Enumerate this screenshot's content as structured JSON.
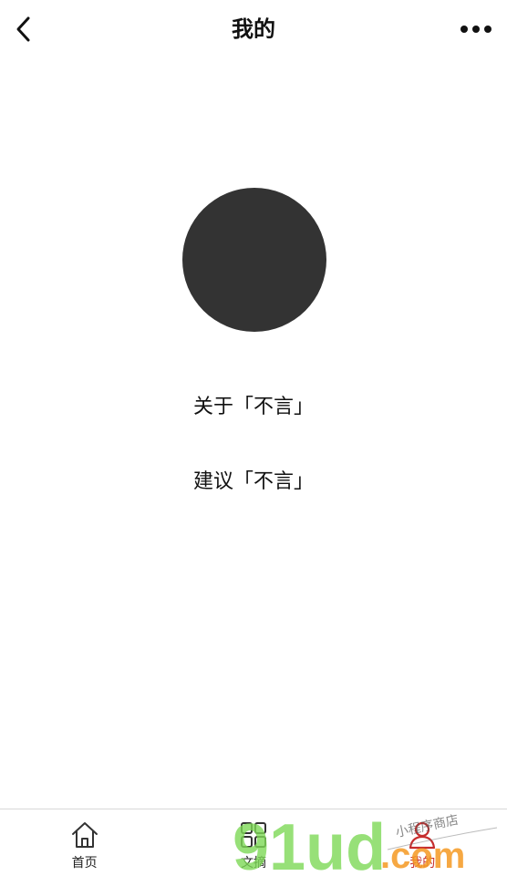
{
  "header": {
    "title": "我的",
    "back_icon": "chevron-left-icon",
    "more_icon": "more-dots-icon"
  },
  "profile": {
    "avatar_color": "#333333"
  },
  "menu": {
    "about_label": "关于「不言」",
    "suggest_label": "建议「不言」"
  },
  "tabbar": {
    "items": [
      {
        "label": "首页",
        "icon": "home-icon",
        "active": false
      },
      {
        "label": "文摘",
        "icon": "grid-icon",
        "active": false
      },
      {
        "label": "我的",
        "icon": "person-icon",
        "active": true
      }
    ],
    "active_color": "#c62d2d"
  },
  "watermark": {
    "text_main": "91ud",
    "text_suffix": ".com",
    "text_small": "小程序商店"
  }
}
